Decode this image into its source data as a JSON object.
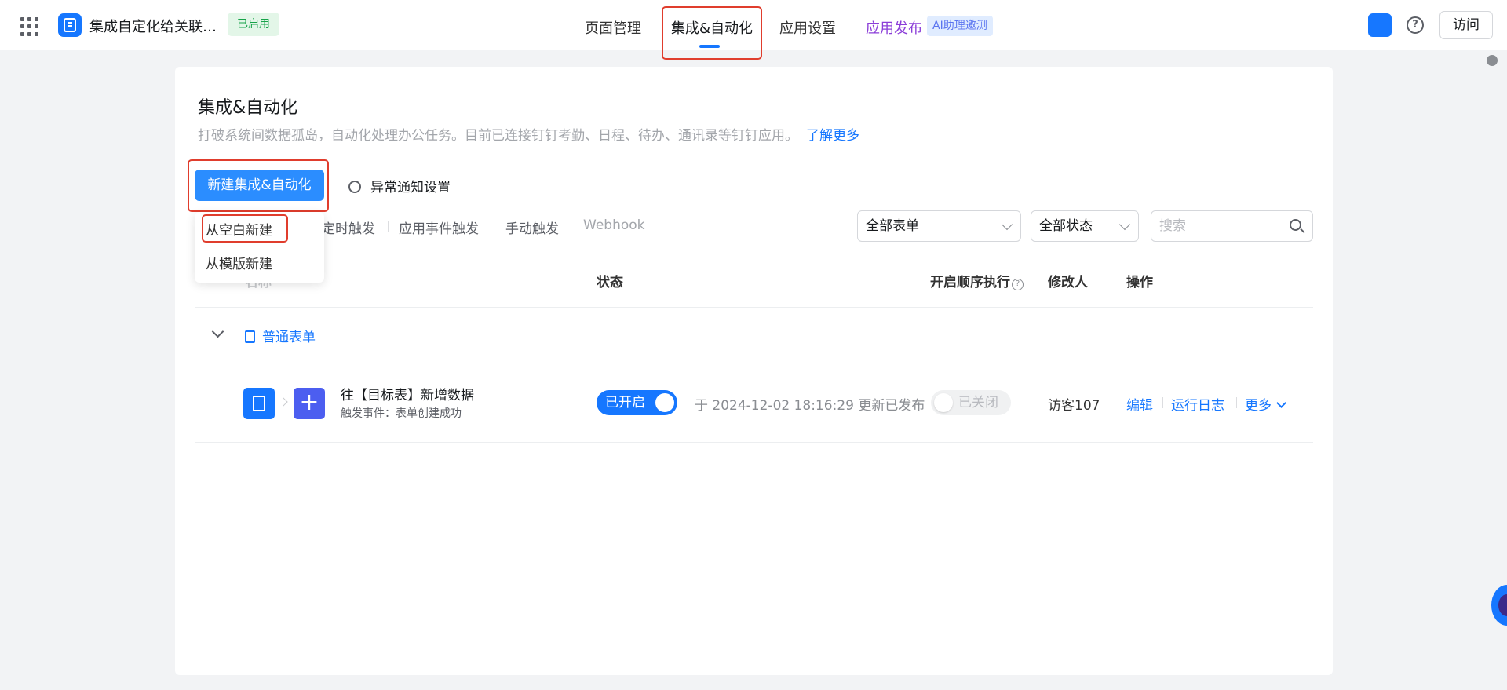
{
  "header": {
    "app_name": "集成自定化给关联…",
    "app_status": "已启用",
    "nav": [
      "页面管理",
      "集成&自动化",
      "应用设置",
      "应用发布"
    ],
    "ai_badge": "AI助理邀测",
    "visit_label": "访问",
    "help_glyph": "?"
  },
  "page": {
    "title": "集成&自动化",
    "description": "打破系统间数据孤岛，自动化处理办公任务。目前已连接钉钉考勤、日程、待办、通讯录等钉钉应用。",
    "learn_more": "了解更多"
  },
  "toolbar": {
    "new_button": "新建集成&自动化",
    "notify_settings": "异常通知设置"
  },
  "dropdown_menu": [
    "从空白新建",
    "从模版新建"
  ],
  "filters": {
    "tabs": [
      "定时触发",
      "应用事件触发",
      "手动触发",
      "Webhook"
    ],
    "form_select": "全部表单",
    "status_select": "全部状态",
    "search_placeholder": "搜索"
  },
  "table": {
    "headers": {
      "name": "名称",
      "status": "状态",
      "sequential": "开启顺序执行",
      "editor": "修改人",
      "ops": "操作"
    },
    "group": "普通表单",
    "rows": [
      {
        "title": "往【目标表】新增数据",
        "subtitle": "触发事件：表单创建成功",
        "status_toggle": "已开启",
        "publish_info": "于 2024-12-02 18:16:29 更新已发布",
        "sequential_toggle": "已关闭",
        "editor": "访客107",
        "ops": [
          "编辑",
          "运行日志",
          "更多"
        ]
      }
    ]
  },
  "icons": [
    "apps-grid-icon",
    "app-logo-icon",
    "assistant-icon",
    "help-icon",
    "gear-icon",
    "search-icon",
    "chevron-down-icon",
    "form-doc-icon",
    "plus-icon"
  ],
  "colors": {
    "accent": "#1677ff",
    "highlight": "#e03d2d",
    "enabled": "#17a34a",
    "publish": "#8b3ed8"
  }
}
